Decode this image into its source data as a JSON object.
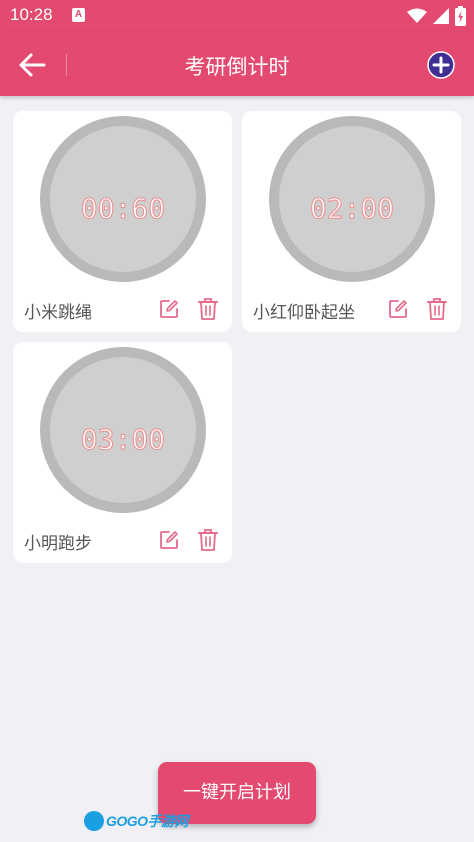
{
  "status_bar": {
    "time": "10:28",
    "notification_letter": "A",
    "icons": [
      "wifi-icon",
      "signal-icon",
      "battery-icon"
    ]
  },
  "app_bar": {
    "title": "考研倒计时",
    "back_icon": "arrow-left-icon",
    "add_icon": "plus-circle-icon"
  },
  "timers": [
    {
      "time": "00:60",
      "name": "小米跳绳"
    },
    {
      "time": "02:00",
      "name": "小红仰卧起坐"
    },
    {
      "time": "03:00",
      "name": "小明跑步"
    }
  ],
  "start_button": {
    "label": "一键开启计划"
  },
  "watermark": {
    "text": "GOGO手游网"
  },
  "colors": {
    "primary": "#e4496f",
    "add_button": "#3f2f93",
    "ring_outer": "#b9b9b9",
    "ring_inner": "#cfcfcf",
    "time_outline": "#ef8b8b",
    "background": "#f1f0f4"
  }
}
